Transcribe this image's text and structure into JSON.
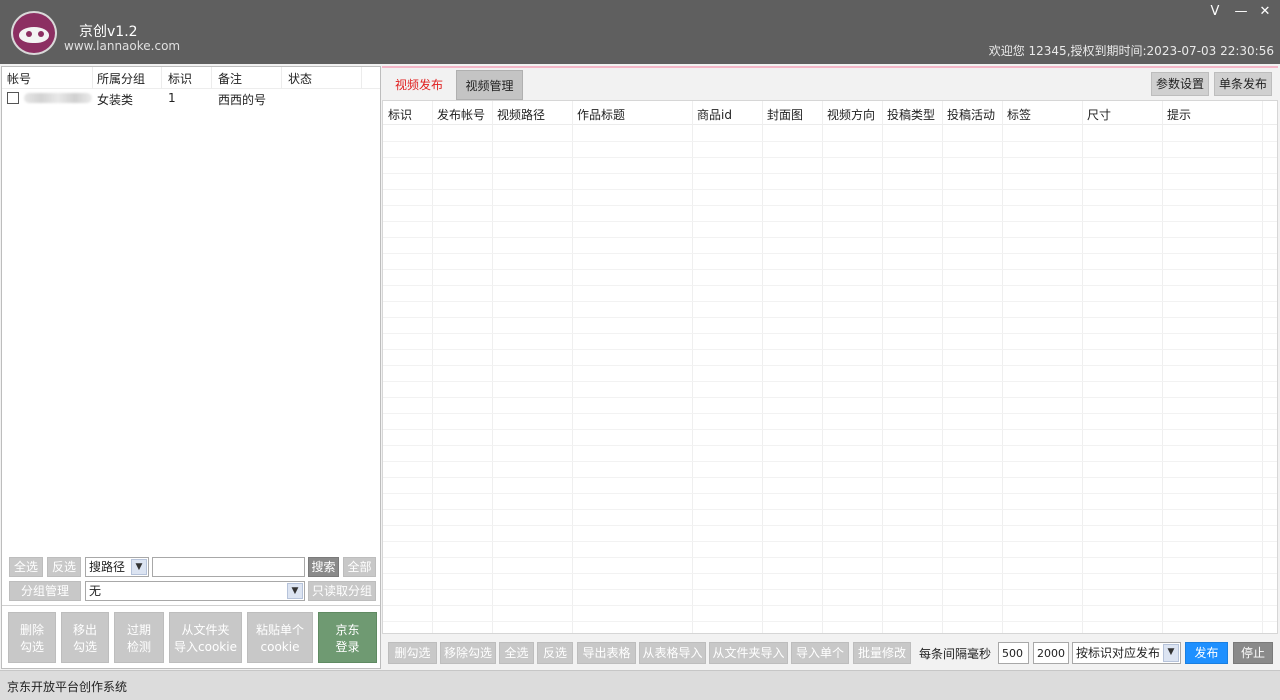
{
  "app": {
    "title": "京创v1.2",
    "url": "www.lannaoke.com",
    "welcome": "欢迎您 12345,授权到期时间:2023-07-03 22:30:56",
    "controls": [
      "V",
      "—",
      "✕"
    ]
  },
  "accounts": {
    "columns": [
      "帐号",
      "所属分组",
      "标识",
      "备注",
      "状态"
    ],
    "rows": [
      {
        "group": "女装类",
        "id": "1",
        "note": "西西的号",
        "status": ""
      }
    ]
  },
  "left_toolbar": {
    "select_all": "全选",
    "invert": "反选",
    "search_type": "搜路径",
    "search_input": "",
    "search": "搜索",
    "all": "全部",
    "group_manage": "分组管理",
    "group_select": "无",
    "readonly_group": "只读取分组"
  },
  "left_actions": [
    "删除\n勾选",
    "移出\n勾选",
    "过期\n检测",
    "从文件夹\n导入cookie",
    "粘贴单个\ncookie",
    "京东\n登录"
  ],
  "tabs": [
    "视频发布",
    "视频管理"
  ],
  "top_buttons": [
    "参数设置",
    "单条发布"
  ],
  "table": {
    "columns": [
      "标识",
      "发布帐号",
      "视频路径",
      "作品标题",
      "商品id",
      "封面图",
      "视频方向",
      "投稿类型",
      "投稿活动",
      "标签",
      "尺寸",
      "提示"
    ]
  },
  "bottom_toolbar": {
    "buttons": [
      "删勾选",
      "移除勾选",
      "全选",
      "反选",
      "导出表格",
      "从表格导入",
      "从文件夹导入",
      "导入单个",
      "批量修改"
    ],
    "interval_label": "每条间隔毫秒",
    "min_ms": "500",
    "max_ms": "2000",
    "mode": "按标识对应发布",
    "publish": "发布",
    "stop": "停止"
  },
  "status_bar": "京东开放平台创作系统",
  "colors": {
    "titlebar": "#5f5f5f",
    "active_tab_text": "#e02020",
    "publish_button": "#1e90ff",
    "login_button": "#6f9a72"
  }
}
